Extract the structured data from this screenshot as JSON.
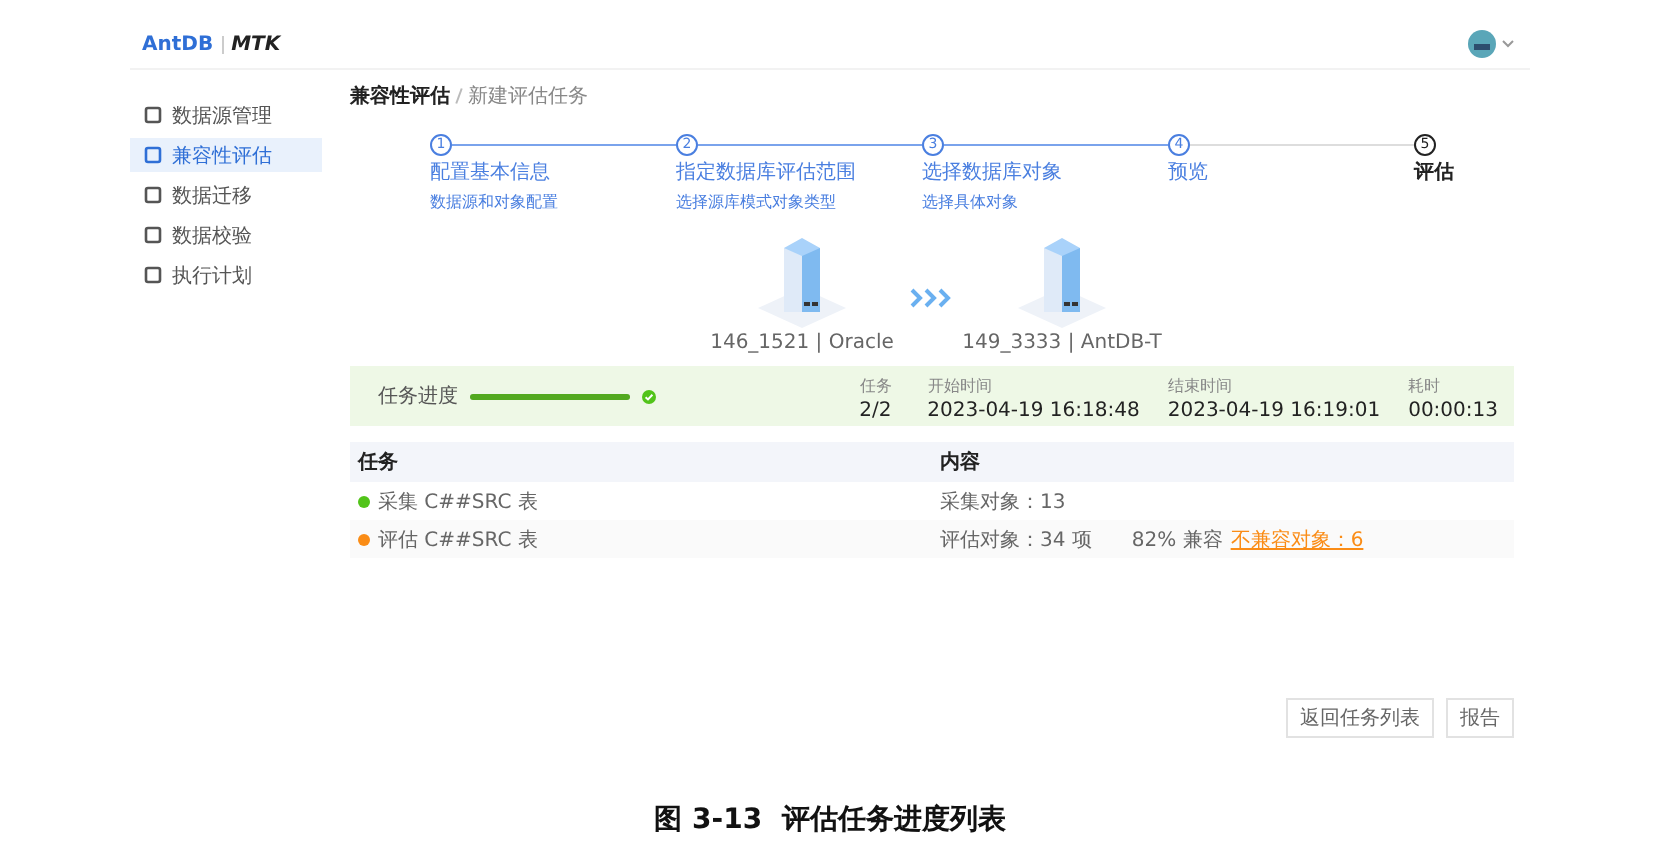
{
  "header": {
    "logo_left": "AntDB",
    "logo_right": "MTK"
  },
  "sidebar": {
    "items": [
      {
        "label": "数据源管理",
        "selected": false
      },
      {
        "label": "兼容性评估",
        "selected": true
      },
      {
        "label": "数据迁移",
        "selected": false
      },
      {
        "label": "数据校验",
        "selected": false
      },
      {
        "label": "执行计划",
        "selected": false
      }
    ]
  },
  "breadcrumb": [
    "兼容性评估",
    "新建评估任务"
  ],
  "steps": [
    {
      "number": "1",
      "title": "配置基本信息",
      "subtitle": "数据源和对象配置",
      "selected": false
    },
    {
      "number": "2",
      "title": "指定数据库评估范围",
      "subtitle": "选择源库模式对象类型",
      "selected": false
    },
    {
      "number": "3",
      "title": "选择数据库对象",
      "subtitle": "选择具体对象",
      "selected": false
    },
    {
      "number": "4",
      "title": "预览",
      "selected": false
    },
    {
      "number": "5",
      "title": "评估",
      "selected": true
    }
  ],
  "servers": [
    "146_1521 | Oracle",
    "149_3333 | AntDB-T"
  ],
  "progress": {
    "label": "任务进度",
    "level": 1,
    "stats": [
      {
        "label": "任务",
        "value": "2/2"
      },
      {
        "label": "开始时间",
        "value": "2023-04-19 16:18:48"
      },
      {
        "label": "结束时间",
        "value": "2023-04-19 16:19:01"
      },
      {
        "label": "耗时",
        "value": "00:00:13"
      }
    ]
  },
  "table": {
    "columns": [
      "任务",
      "内容"
    ],
    "rows": [
      {
        "task": "采集 C##SRC 表",
        "color": "#52c41a",
        "content": [
          {
            "text": "采集对象：13",
            "kind": "plain"
          }
        ]
      },
      {
        "task": "评估 C##SRC 表",
        "color": "#fa8c16",
        "content": [
          {
            "text": "评估对象：34 项",
            "kind": "plain"
          },
          {
            "text": "82% 兼容",
            "kind": "plain"
          },
          {
            "text": "不兼容对象：6",
            "kind": "warning"
          }
        ]
      }
    ]
  },
  "buttons": [
    "返回任务列表",
    "报告"
  ],
  "caption": "图 3-13  评估任务进度列表"
}
